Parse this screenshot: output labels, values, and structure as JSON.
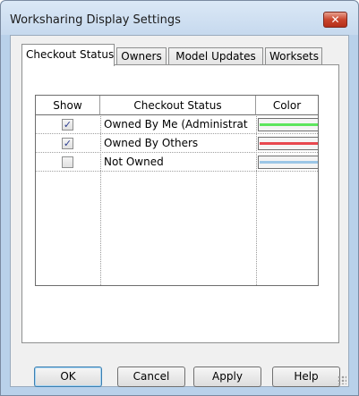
{
  "window": {
    "title": "Worksharing Display Settings",
    "close_glyph": "✕"
  },
  "tabs": [
    {
      "label": "Checkout Status",
      "active": true
    },
    {
      "label": "Owners",
      "active": false
    },
    {
      "label": "Model Updates",
      "active": false
    },
    {
      "label": "Worksets",
      "active": false
    }
  ],
  "grid": {
    "columns": {
      "show": "Show",
      "status": "Checkout Status",
      "color": "Color"
    },
    "rows": [
      {
        "checked": true,
        "check_glyph": "✓",
        "status": "Owned By Me (Administrat",
        "color": "#5ee65e"
      },
      {
        "checked": true,
        "check_glyph": "✓",
        "status": "Owned By Others",
        "color": "#e8484f"
      },
      {
        "checked": false,
        "check_glyph": "",
        "status": "Not Owned",
        "color": "#9cc6e6"
      }
    ]
  },
  "buttons": {
    "ok": "OK",
    "cancel": "Cancel",
    "apply": "Apply",
    "help": "Help"
  }
}
